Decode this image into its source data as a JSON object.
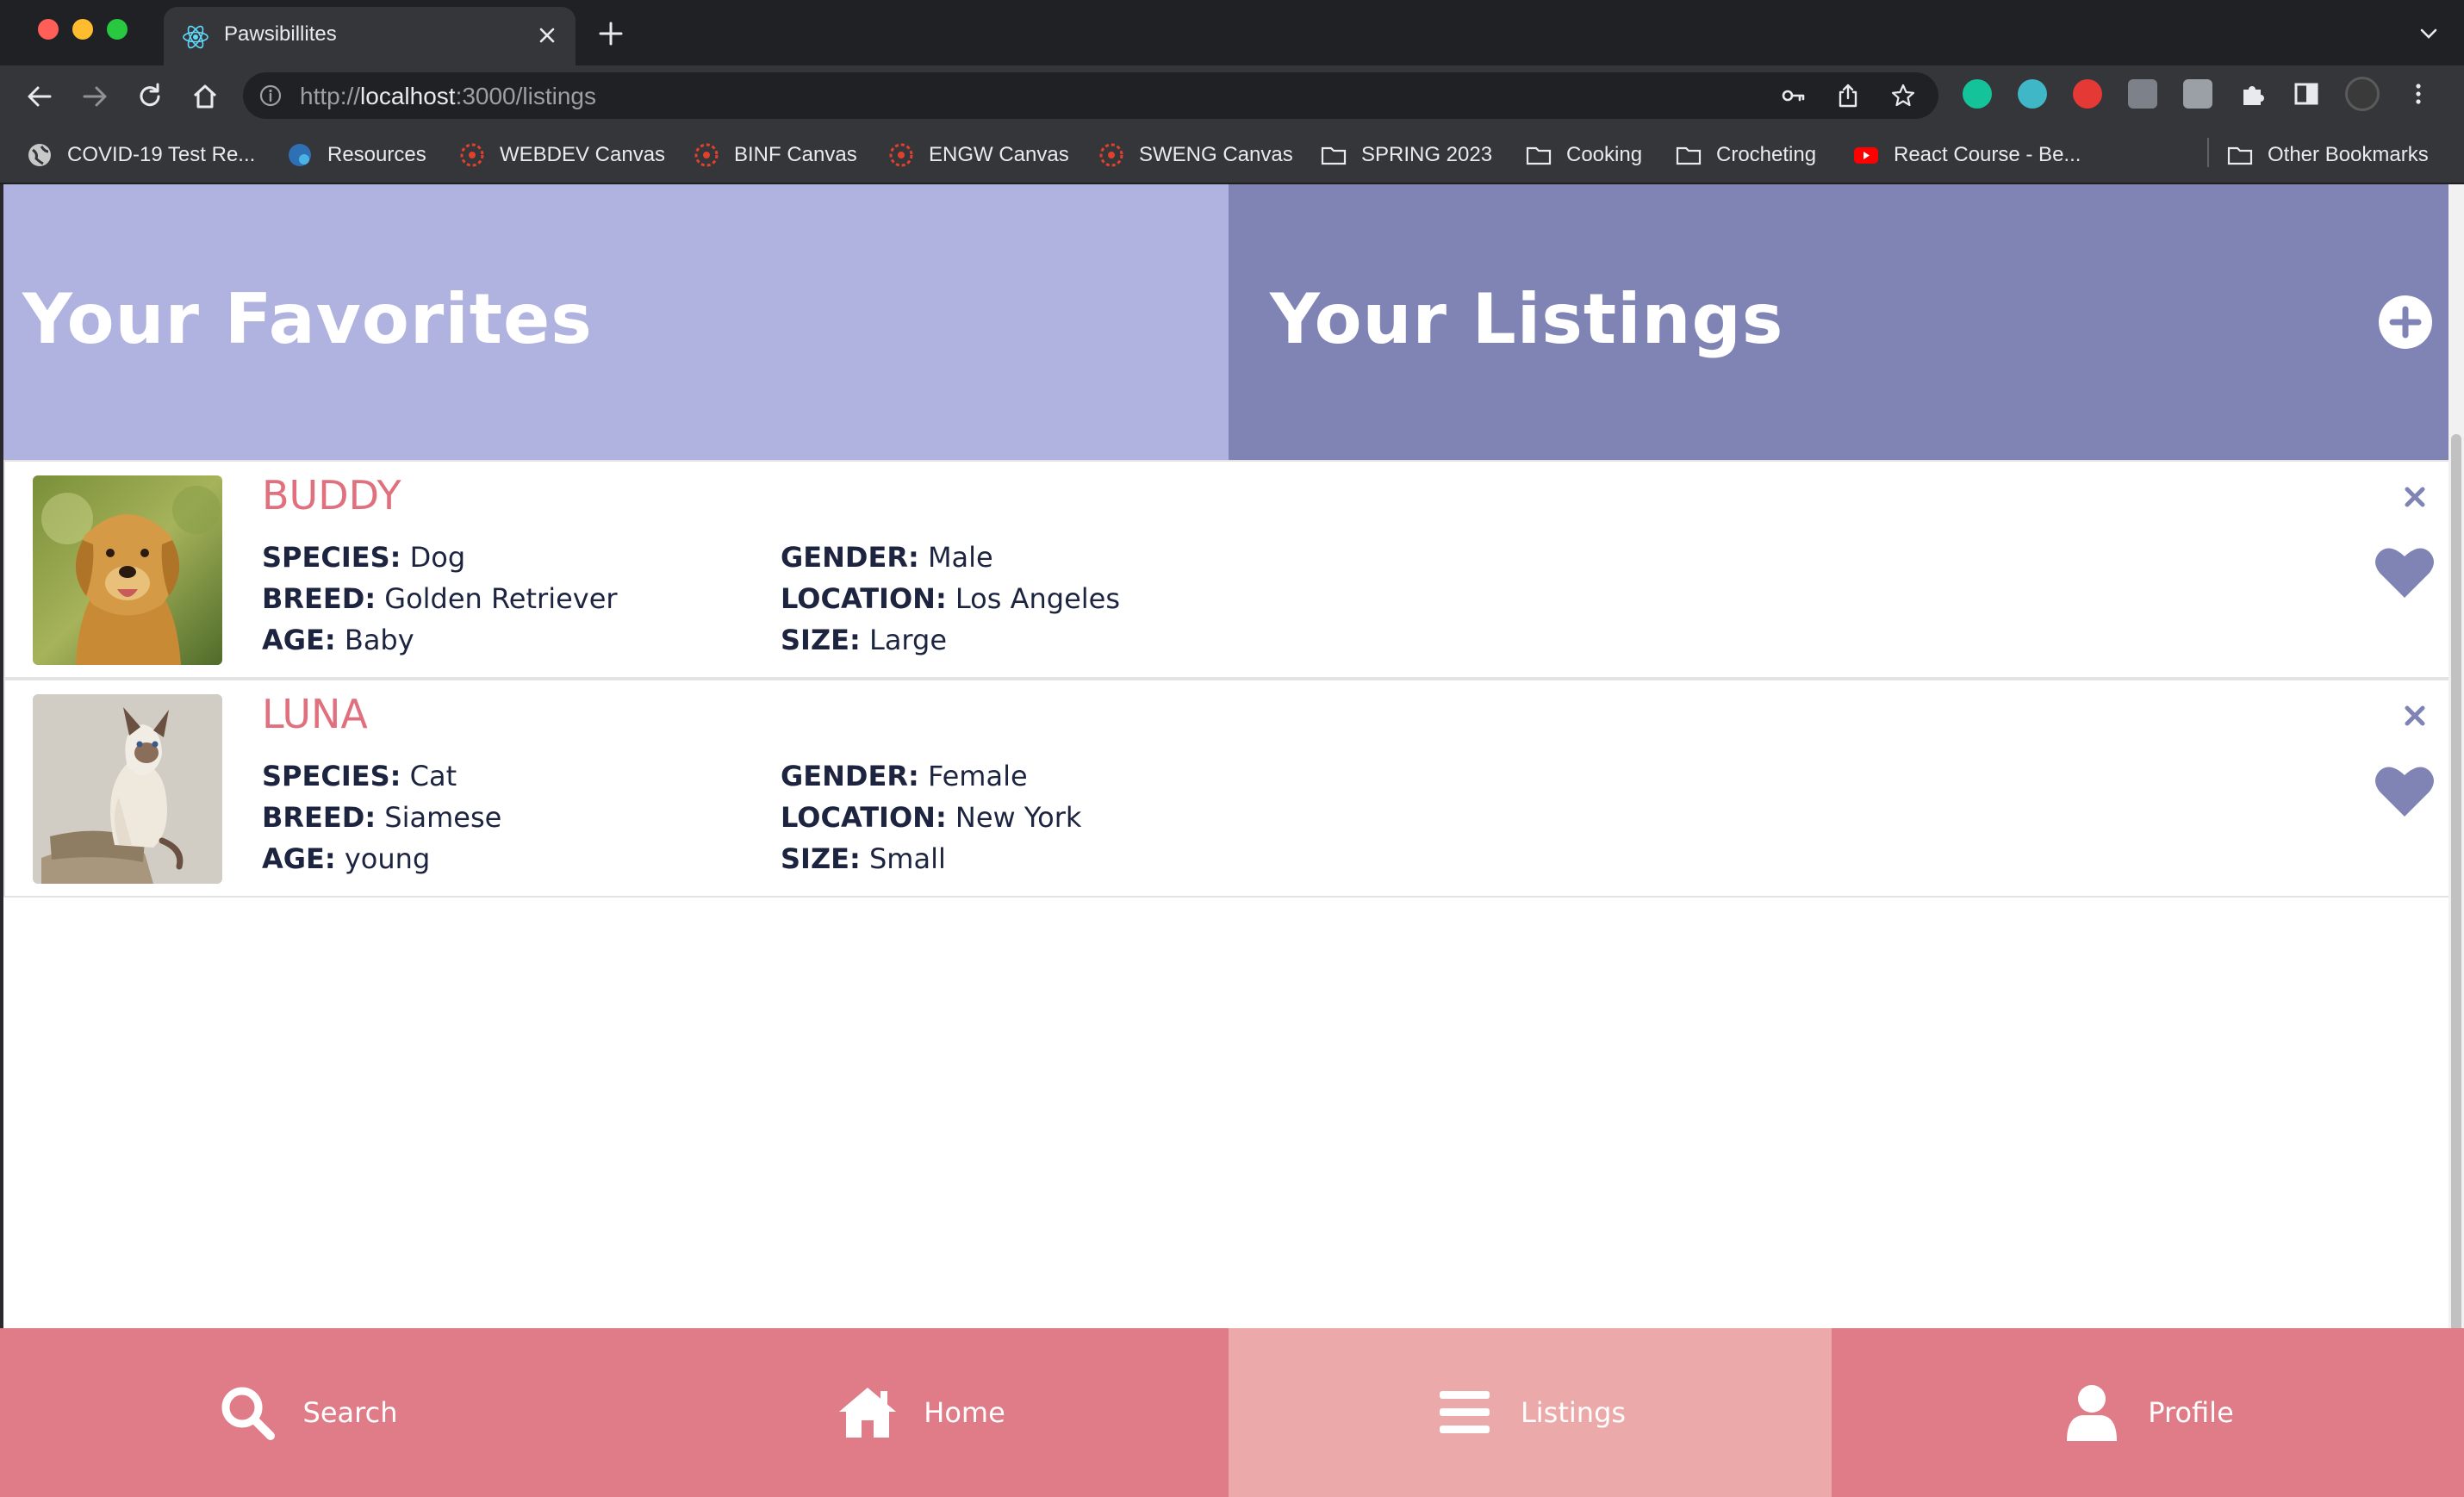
{
  "browser": {
    "tab_title": "Pawsibillites",
    "url_scheme": "http://",
    "url_host": "localhost",
    "url_rest": ":3000/listings",
    "bookmarks": [
      {
        "label": "COVID-19 Test Re...",
        "icon": "globe-icon"
      },
      {
        "label": "Resources",
        "icon": "site-icon"
      },
      {
        "label": "WEBDEV Canvas",
        "icon": "canvas-icon"
      },
      {
        "label": "BINF Canvas",
        "icon": "canvas-icon"
      },
      {
        "label": "ENGW Canvas",
        "icon": "canvas-icon"
      },
      {
        "label": "SWENG Canvas",
        "icon": "canvas-icon"
      },
      {
        "label": "SPRING 2023",
        "icon": "folder-icon"
      },
      {
        "label": "Cooking",
        "icon": "folder-icon"
      },
      {
        "label": "Crocheting",
        "icon": "folder-icon"
      },
      {
        "label": "React Course - Be...",
        "icon": "youtube-icon"
      }
    ],
    "other_bookmarks": "Other Bookmarks"
  },
  "header": {
    "favorites_title": "Your Favorites",
    "listings_title": "Your Listings"
  },
  "pets": [
    {
      "name": "BUDDY",
      "species_label": "SPECIES:",
      "species": "Dog",
      "breed_label": "BREED:",
      "breed": "Golden Retriever",
      "age_label": "AGE:",
      "age": "Baby",
      "gender_label": "GENDER:",
      "gender": "Male",
      "location_label": "LOCATION:",
      "location": "Los Angeles",
      "size_label": "SIZE:",
      "size": "Large"
    },
    {
      "name": "LUNA",
      "species_label": "SPECIES:",
      "species": "Cat",
      "breed_label": "BREED:",
      "breed": "Siamese",
      "age_label": "AGE:",
      "age": "young",
      "gender_label": "GENDER:",
      "gender": "Female",
      "location_label": "LOCATION:",
      "location": "New York",
      "size_label": "SIZE:",
      "size": "Small"
    }
  ],
  "nav": {
    "search": "Search",
    "home": "Home",
    "listings": "Listings",
    "profile": "Profile"
  },
  "colors": {
    "favorites_bg": "#b0b2e0",
    "listings_bg": "#8084b4",
    "pet_name": "#e0707e",
    "nav_bg": "#e07c88",
    "nav_active_bg": "#eca9a9",
    "heart": "#8084b4"
  }
}
